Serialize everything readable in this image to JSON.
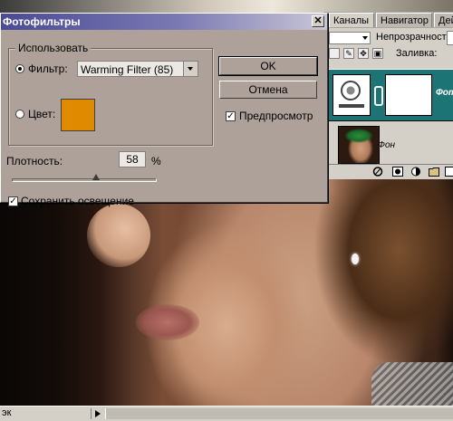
{
  "dialog": {
    "title": "Фотофильтры",
    "close_glyph": "✕",
    "group_label": "Использовать",
    "filter_label": "Фильтр:",
    "filter_value": "Warming Filter (85)",
    "filter_selected": true,
    "color_label": "Цвет:",
    "color_swatch": "#e08a00",
    "ok_label": "OK",
    "cancel_label": "Отмена",
    "preview_label": "Предпросмотр",
    "preview_checked": true,
    "density_label": "Плотность:",
    "density_value": "58",
    "density_unit": "%",
    "density_fraction": 0.58,
    "preserve_label": "Сохранить освещение",
    "preserve_checked": true,
    "check_glyph": "✓"
  },
  "layers_panel": {
    "tabs": [
      "Каналы",
      "Навигатор",
      "Дейс"
    ],
    "opacity_label": "Непрозрачность:",
    "fill_label": "Заливка:",
    "selected_layer_name": "Фото",
    "background_layer_name": "Фон",
    "accent": "#1d7474"
  },
  "status_bar": {
    "text": "эк"
  }
}
